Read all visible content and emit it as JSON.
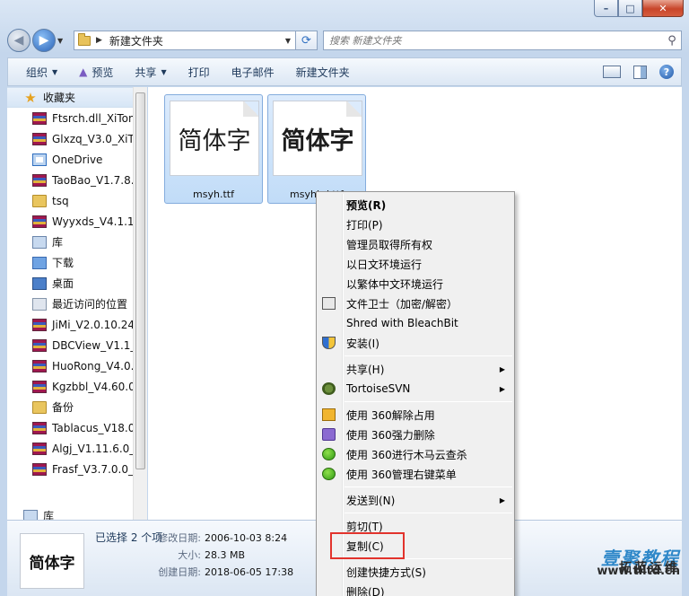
{
  "address": {
    "path": "新建文件夹"
  },
  "search": {
    "placeholder": "搜索 新建文件夹"
  },
  "toolbar": {
    "organize": "组织",
    "preview": "预览",
    "share": "共享",
    "print": "打印",
    "email": "电子邮件",
    "new_folder": "新建文件夹"
  },
  "sidebar": {
    "header": "收藏夹",
    "items": [
      {
        "label": "Ftsrch.dll_XiTon",
        "icon": "winrar-icon"
      },
      {
        "label": "Glxzq_V3.0_XiTo",
        "icon": "winrar-icon"
      },
      {
        "label": "OneDrive",
        "icon": "onedrive-icon"
      },
      {
        "label": "TaoBao_V1.7.8.",
        "icon": "winrar-icon"
      },
      {
        "label": "tsq",
        "icon": "folder-icon"
      },
      {
        "label": "Wyyxds_V4.1.1.",
        "icon": "winrar-icon"
      },
      {
        "label": "库",
        "icon": "library-icon"
      },
      {
        "label": "下载",
        "icon": "downloads-icon"
      },
      {
        "label": "桌面",
        "icon": "desktop-icon"
      },
      {
        "label": "最近访问的位置",
        "icon": "recent-icon"
      },
      {
        "label": "JiMi_V2.0.10.24_",
        "icon": "winrar-icon"
      },
      {
        "label": "DBCView_V1.1_",
        "icon": "winrar-icon"
      },
      {
        "label": "HuoRong_V4.0.",
        "icon": "winrar-icon"
      },
      {
        "label": "Kgzbbl_V4.60.0",
        "icon": "winrar-icon"
      },
      {
        "label": "备份",
        "icon": "folder-icon"
      },
      {
        "label": "Tablacus_V18.0",
        "icon": "winrar-icon"
      },
      {
        "label": "Algj_V1.11.6.0_X",
        "icon": "winrar-icon"
      },
      {
        "label": "Frasf_V3.7.0.0_X",
        "icon": "winrar-icon"
      }
    ],
    "footer": "库"
  },
  "files": [
    {
      "preview": "简体字",
      "name": "msyh.ttf"
    },
    {
      "preview": "简体字",
      "name": "msyhbd.ttf"
    }
  ],
  "context_menu": {
    "preview": "预览(R)",
    "print": "打印(P)",
    "take_ownership": "管理员取得所有权",
    "run_japanese": "以日文环境运行",
    "run_traditional": "以繁体中文环境运行",
    "file_guard": "文件卫士（加密/解密）",
    "shred": "Shred with BleachBit",
    "install": "安装(I)",
    "share": "共享(H)",
    "tortoise": "TortoiseSVN",
    "unlock360": "使用 360解除占用",
    "delete360": "使用 360强力删除",
    "scan360": "使用 360进行木马云查杀",
    "manage360": "使用 360管理右键菜单",
    "send_to": "发送到(N)",
    "cut": "剪切(T)",
    "copy": "复制(C)",
    "create_shortcut": "创建快捷方式(S)",
    "delete": "删除(D)"
  },
  "details": {
    "thumb": "简体字",
    "selected": "已选择 2 个项",
    "modified_label": "修改日期:",
    "modified": "2006-10-03 8:24",
    "size_label": "大小:",
    "size": "28.3 MB",
    "created_label": "创建日期:",
    "created": "2018-06-05 17:38"
  },
  "watermark": {
    "brand": "壹聚教程",
    "cn": "拓蓝运维",
    "url": "www.tlltd.cn"
  },
  "colors": {
    "accent": "#2f6fc0",
    "highlight": "#e2332c"
  }
}
